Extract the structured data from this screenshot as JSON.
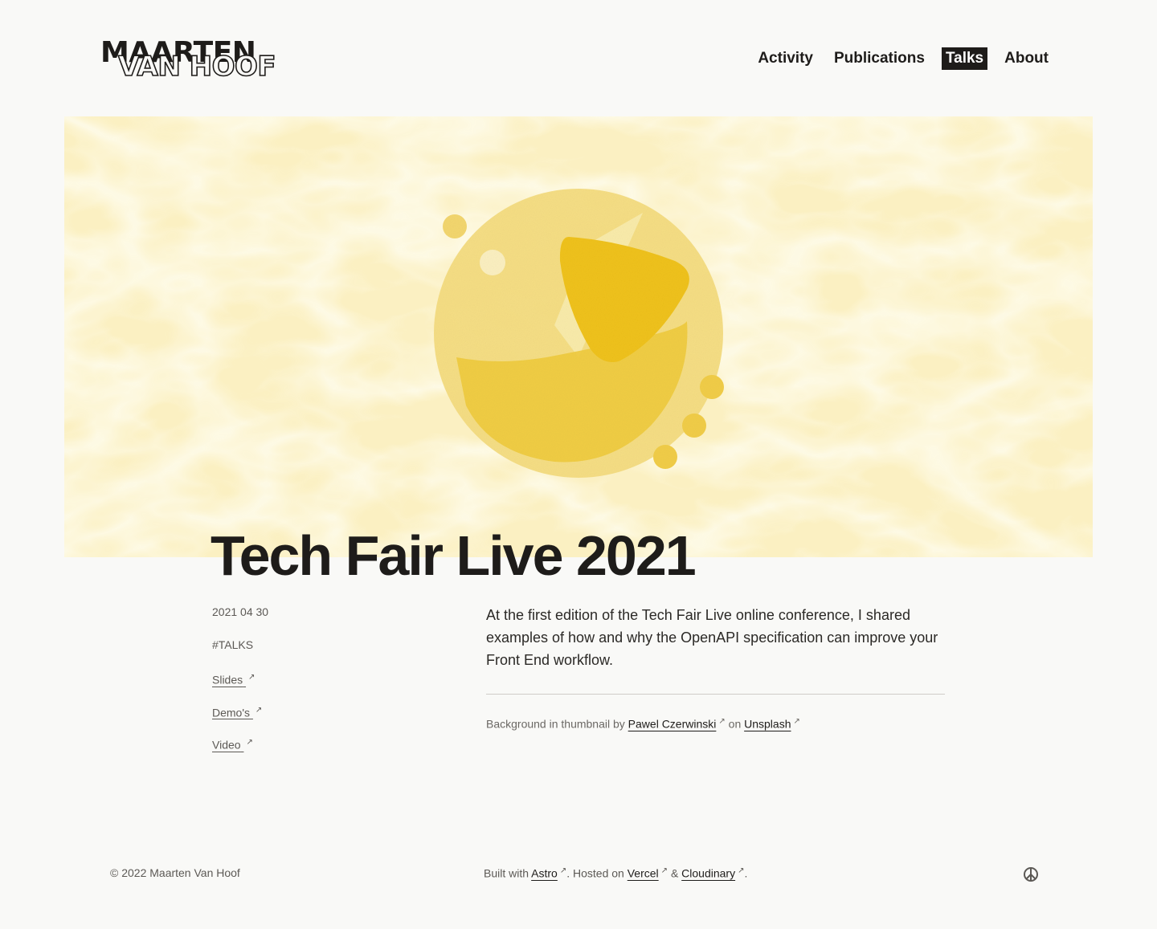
{
  "header": {
    "logo_line1": "MAARTEN",
    "logo_line2": "VAN HOOF",
    "nav": [
      {
        "label": "Activity",
        "active": false
      },
      {
        "label": "Publications",
        "active": false
      },
      {
        "label": "Talks",
        "active": true
      },
      {
        "label": "About",
        "active": false
      }
    ]
  },
  "post": {
    "title": "Tech Fair Live 2021",
    "date": "2021 04 30",
    "tag": "#TALKS",
    "links": [
      "Slides",
      "Demo's",
      "Video"
    ],
    "description": "At the first edition of the Tech Fair Live online conference, I shared examples of how and why the OpenAPI specification can improve your Front End workflow.",
    "credit_prefix": "Background in thumbnail by",
    "credit_author": "Pawel Czerwinski",
    "credit_on": "on",
    "credit_site": "Unsplash"
  },
  "footer": {
    "copyright": "© 2022 Maarten Van Hoof",
    "built_prefix": "Built with",
    "built_astro": "Astro",
    "hosted_prefix": ". Hosted on",
    "hosted_vercel": "Vercel",
    "amp": "&",
    "hosted_cloudinary": "Cloudinary",
    "end": "."
  },
  "icons": {
    "external_link": "external-link-icon",
    "peace": "peace-icon"
  },
  "colors": {
    "background": "#f9f9f7",
    "text": "#1e1c1a",
    "hero_background": "#fbf2c8",
    "hero_shape_light": "#f4d86e",
    "hero_shape_dark": "#efc21a"
  }
}
